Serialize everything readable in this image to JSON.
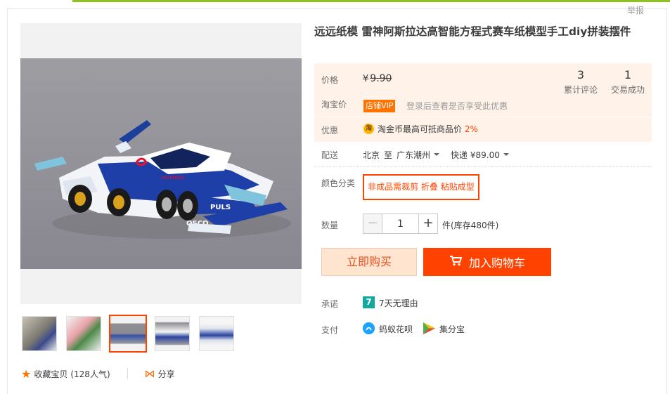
{
  "header": {
    "report_label": "举报"
  },
  "product": {
    "title": "远远纸模 雷神阿斯拉达高智能方程式赛车纸模型手工diy拼装摆件"
  },
  "price_panel": {
    "price_label": "价格",
    "currency": "¥",
    "original_price": "9.90",
    "stats": [
      {
        "value": "3",
        "label": "累计评论"
      },
      {
        "value": "1",
        "label": "交易成功"
      }
    ],
    "taobao_price_label": "淘宝价",
    "vip_badge": "店铺VIP",
    "vip_text": "登录后查看是否享受此优惠",
    "promo_label": "优惠",
    "coin_icon": "淘",
    "coin_text": "淘金币最高可抵商品价",
    "coin_pct": "2%"
  },
  "shipping": {
    "label": "配送",
    "from": "北京",
    "to_word": "至",
    "destination": "广东潮州",
    "method": "快递 ¥89.00"
  },
  "sku": {
    "label": "颜色分类",
    "options": [
      {
        "text": "非成品需裁剪 折叠 粘贴成型",
        "selected": true
      }
    ]
  },
  "quantity": {
    "label": "数量",
    "minus": "−",
    "plus": "+",
    "value": "1",
    "stock_text": "件(库存480件)"
  },
  "actions": {
    "buy_now": "立即购买",
    "add_to_cart": "加入购物车"
  },
  "services": {
    "promise_label": "承诺",
    "promise_icon": "7",
    "promise_text": "7天无理由",
    "pay_label": "支付",
    "pay_methods": [
      "蚂蚁花呗",
      "集分宝"
    ]
  },
  "social": {
    "favorite_text": "收藏宝贝",
    "popularity": "(128人气)",
    "share_text": "分享"
  },
  "colors": {
    "accent": "#ff4400",
    "buy_bg": "#ffe4d0",
    "cart_bg": "#ff4200",
    "panel_bg": "#fff2e8",
    "top_bar": "#8dc21f"
  }
}
